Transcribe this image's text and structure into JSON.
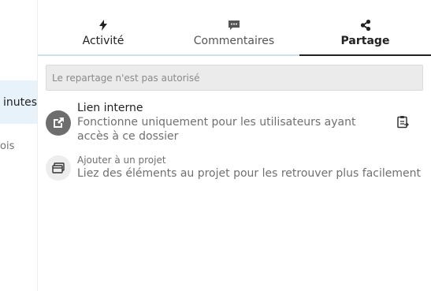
{
  "left_pane": {
    "row_active_fragment": "inutes",
    "row_other_fragment": "ois"
  },
  "tabs": [
    {
      "label": "Activité",
      "icon": "lightning-icon",
      "state": "normal"
    },
    {
      "label": "Commentaires",
      "icon": "comment-icon",
      "state": "muted"
    },
    {
      "label": "Partage",
      "icon": "share-icon",
      "state": "active"
    }
  ],
  "sharing": {
    "notice": "Le repartage n'est pas autorisé",
    "internal_link": {
      "title": "Lien interne",
      "description": "Fonctionne uniquement pour les utilisateurs ayant accès à ce dossier",
      "icon": "external-link-icon",
      "action_icon": "clipboard-icon"
    },
    "project": {
      "title": "Ajouter à un projet",
      "description": "Liez des éléments au projet pour les retrouver plus facilement",
      "icon": "project-icon"
    }
  },
  "colors": {
    "active_row_bg": "#e8f2fa",
    "active_tab_underline": "#222222",
    "tab_underline": "#cfe0ea",
    "notice_bg": "#ebebeb",
    "avatar_dark": "#6e6e6e"
  }
}
